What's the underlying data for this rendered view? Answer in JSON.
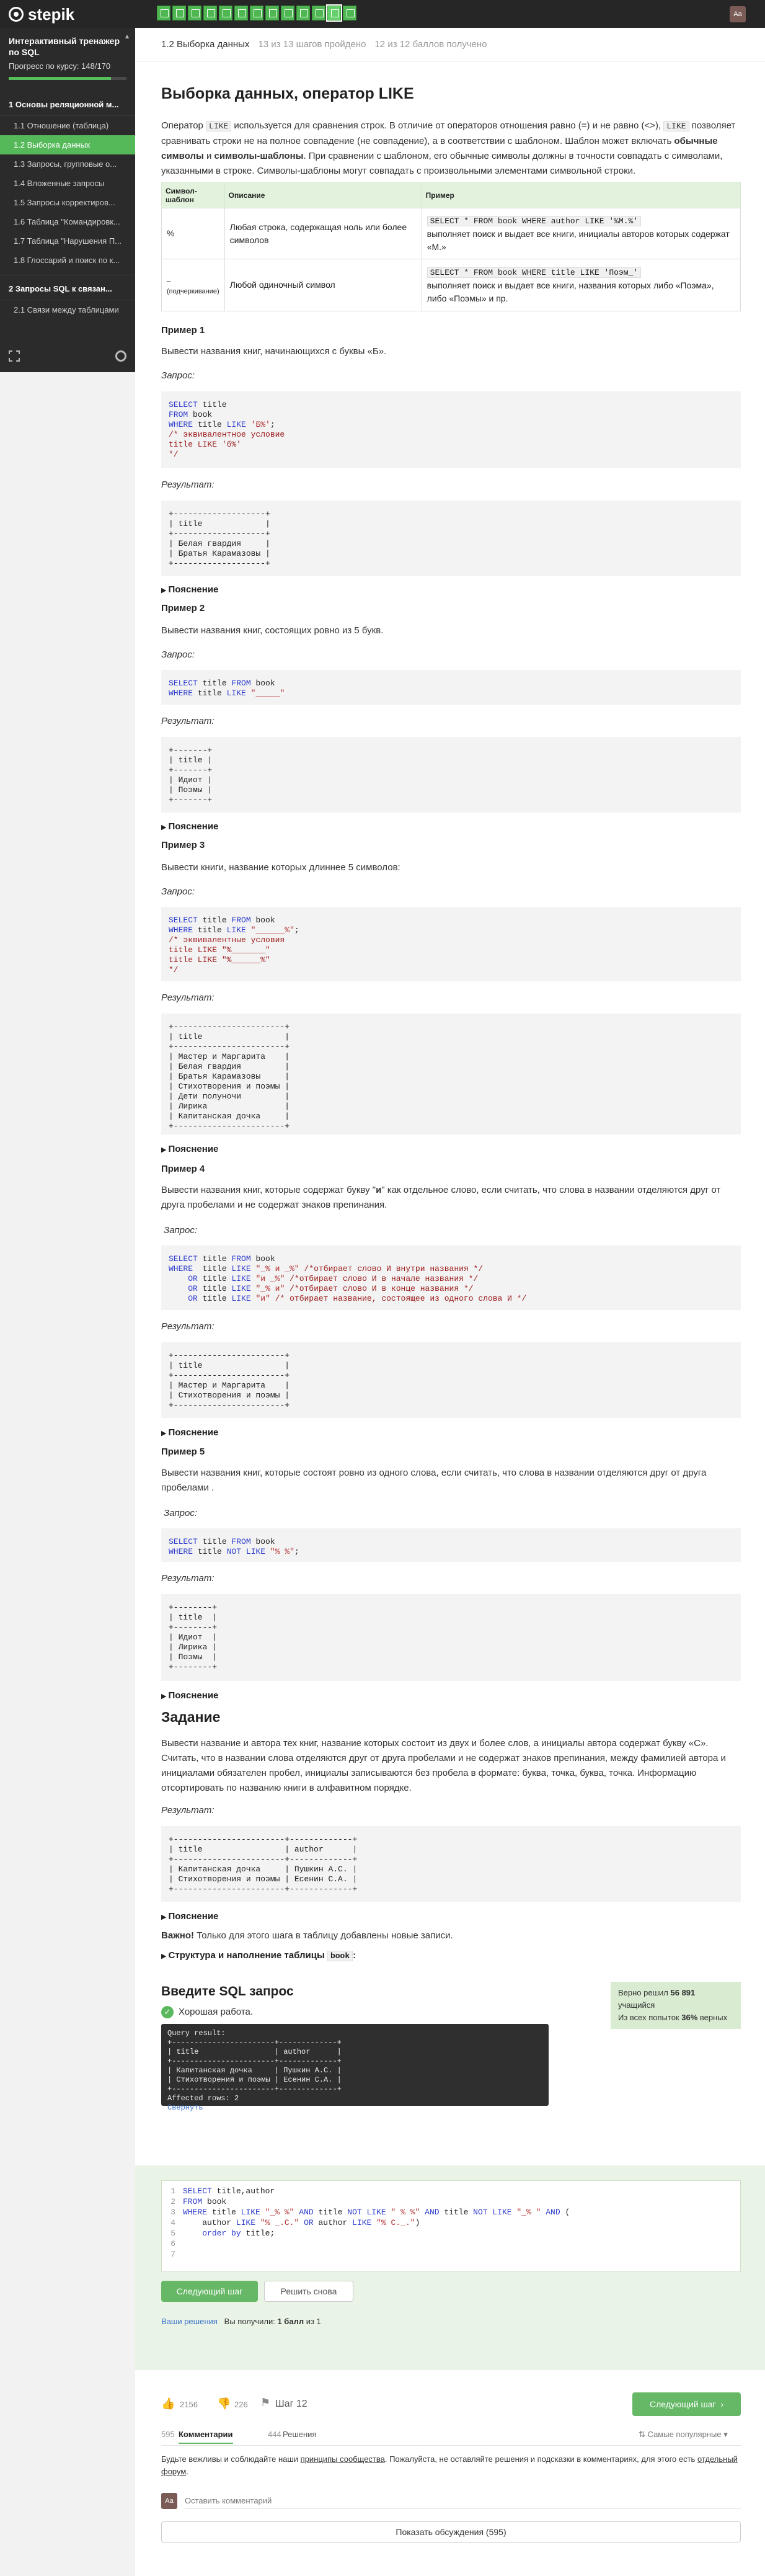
{
  "header": {
    "logo": "stepik",
    "user_initials": "Aa"
  },
  "sidebar": {
    "course_title": "Интерактивный тренажер по SQL",
    "progress_label": "Прогресс по курсу:  148/170",
    "progress_fraction": 0.87,
    "module1": "1  Основы реляционной м...",
    "items": [
      "1.1  Отношение (таблица)",
      "1.2  Выборка данных",
      "1.3  Запросы, групповые о...",
      "1.4  Вложенные запросы",
      "1.5  Запросы корректиров...",
      "1.6  Таблица \"Командировк...",
      "1.7  Таблица \"Нарушения П...",
      "1.8  Глоссарий и поиск по к..."
    ],
    "module2": "2  Запросы SQL к связан...",
    "module2_items": [
      "2.1  Связи между таблицами"
    ]
  },
  "crumb": {
    "title": "1.2 Выборка данных",
    "steps_done": "13 из 13 шагов пройдено",
    "points": "12 из 12 баллов  получено"
  },
  "article": {
    "title": "Выборка данных, оператор LIKE",
    "intro_a": "Оператор ",
    "intro_like": "LIKE",
    "intro_b": " используется для сравнения строк. В отличие от операторов отношения равно (=) и не равно (<>), ",
    "intro_like2": "LIKE",
    "intro_c": " позволяет сравнивать строки не на полное совпадение (не совпадение), а в соответствии с шаблоном. Шаблон может включать ",
    "intro_bold": "обычные символы",
    "intro_d": " и ",
    "intro_bold2": "символы-шаблоны",
    "intro_e": ". При сравнении с шаблоном, его обычные символы должны в точности совпадать с символами, указанными в строке. Символы-шаблоны могут совпадать с произвольными элементами символьной строки.",
    "table_headers": [
      "Символ-шаблон",
      "Описание",
      "Пример"
    ],
    "table_rows": [
      {
        "sym": "%",
        "desc": "Любая строка, содержащая ноль или более символов",
        "ex_code": "SELECT * FROM book WHERE author LIKE '%М.%'",
        "ex_text": "выполняет поиск и выдает все книги, инициалы авторов которых содержат «М.»"
      },
      {
        "sym": "_ (подчеркивание)",
        "desc": "Любой одиночный символ",
        "ex_code": "SELECT * FROM book WHERE title LIKE 'Поэм_'",
        "ex_text": "выполняет поиск и выдает все книги, названия которых либо «Поэма», либо «Поэмы» и пр."
      }
    ],
    "query_label": "Запрос:",
    "result_label": "Результат:",
    "explain": "Пояснение",
    "examples": [
      {
        "title": "Пример 1",
        "text": "Вывести названия книг, начинающихся с буквы «Б».",
        "result": "+-------------------+\n| title             |\n+-------------------+\n| Белая гвардия     |\n| Братья Карамазовы |\n+-------------------+"
      },
      {
        "title": "Пример 2",
        "text": "Вывести названия книг, состоящих ровно из 5 букв.",
        "result": "+-------+\n| title |\n+-------+\n| Идиот |\n| Поэмы |\n+-------+"
      },
      {
        "title": "Пример 3",
        "text": "Вывести книги, название которых длиннее 5 символов:",
        "result": "+-----------------------+\n| title                 |\n+-----------------------+\n| Мастер и Маргарита    |\n| Белая гвардия         |\n| Братья Карамазовы     |\n| Стихотворения и поэмы |\n| Дети полуночи         |\n| Лирика                |\n| Капитанская дочка     |\n+-----------------------+"
      },
      {
        "title": "Пример 4",
        "text_a": "Вывести названия книг, которые содержат букву \"",
        "text_b": "и",
        "text_c": "\" как отдельное слово, если считать, что слова в названии отделяются друг от друга пробелами и не содержат знаков препинания.",
        "result": "+-----------------------+\n| title                 |\n+-----------------------+\n| Мастер и Маргарита    |\n| Стихотворения и поэмы |\n+-----------------------+"
      },
      {
        "title": "Пример 5",
        "text": "Вывести названия книг, которые состоят ровно из одного слова, если считать, что слова в названии отделяются друг от друга пробелами .",
        "result": "+--------+\n| title  |\n+--------+\n| Идиот  |\n| Лирика |\n| Поэмы  |\n+--------+"
      }
    ],
    "task_title": "Задание",
    "task_text": "Вывести название и автора тех книг, название которых состоит из двух и более слов, а инициалы автора содержат букву «С». Считать, что в названии слова отделяются друг от друга пробелами и не содержат знаков препинания, между фамилией автора и инициалами обязателен пробел, инициалы записываются без пробела в формате: буква, точка, буква, точка. Информацию отсортировать по названию книги в алфавитном порядке.",
    "task_result": "+-----------------------+-------------+\n| title                 | author      |\n+-----------------------+-------------+\n| Капитанская дочка     | Пушкин А.С. |\n| Стихотворения и поэмы | Есенин С.А. |\n+-----------------------+-------------+",
    "important_bold": "Важно!",
    "important_text": " Только для этого шага в таблицу добавлены новые записи.",
    "struct_toggle": "Структура и наполнение таблицы ",
    "struct_code": "book",
    "struct_colon": ":"
  },
  "solve": {
    "title": "Введите SQL запрос",
    "good": "Хорошая работа.",
    "result_text": "Query result:\n+-----------------------+-------------+\n| title                 | author      |\n+-----------------------+-------------+\n| Капитанская дочка     | Пушкин А.С. |\n| Стихотворения и поэмы | Есенин С.А. |\n+-----------------------+-------------+\nAffected rows: 2",
    "collapse": "Свернуть",
    "stats_a": "Верно решил ",
    "stats_b": "56 891",
    "stats_c": " учащийся",
    "stats_d": "Из всех попыток ",
    "stats_e": "36%",
    "stats_f": " верных",
    "next_btn": "Следующий шаг",
    "retry_btn": "Решить снова",
    "your_solutions": "Ваши решения",
    "points_a": "Вы получили: ",
    "points_b": "1 балл",
    "points_c": " из 1"
  },
  "footer": {
    "likes": "2156",
    "dislikes": "226",
    "step": "Шаг 12",
    "next_btn": "Следующий шаг",
    "comments_count": "595",
    "comments_tab": "Комментарии",
    "solutions_count": "444",
    "solutions_tab": "Решения",
    "sort": "Самые популярные",
    "rules_a": "Будьте вежливы и соблюдайте наши ",
    "rules_link": "принципы сообщества",
    "rules_b": ". Пожалуйста, не оставляйте решения и подсказки в комментариях, для этого есть ",
    "rules_link2": "отдельный форум",
    "rules_c": ".",
    "comment_placeholder": "Оставить комментарий",
    "show_discussions": "Показать обсуждения (595)"
  }
}
